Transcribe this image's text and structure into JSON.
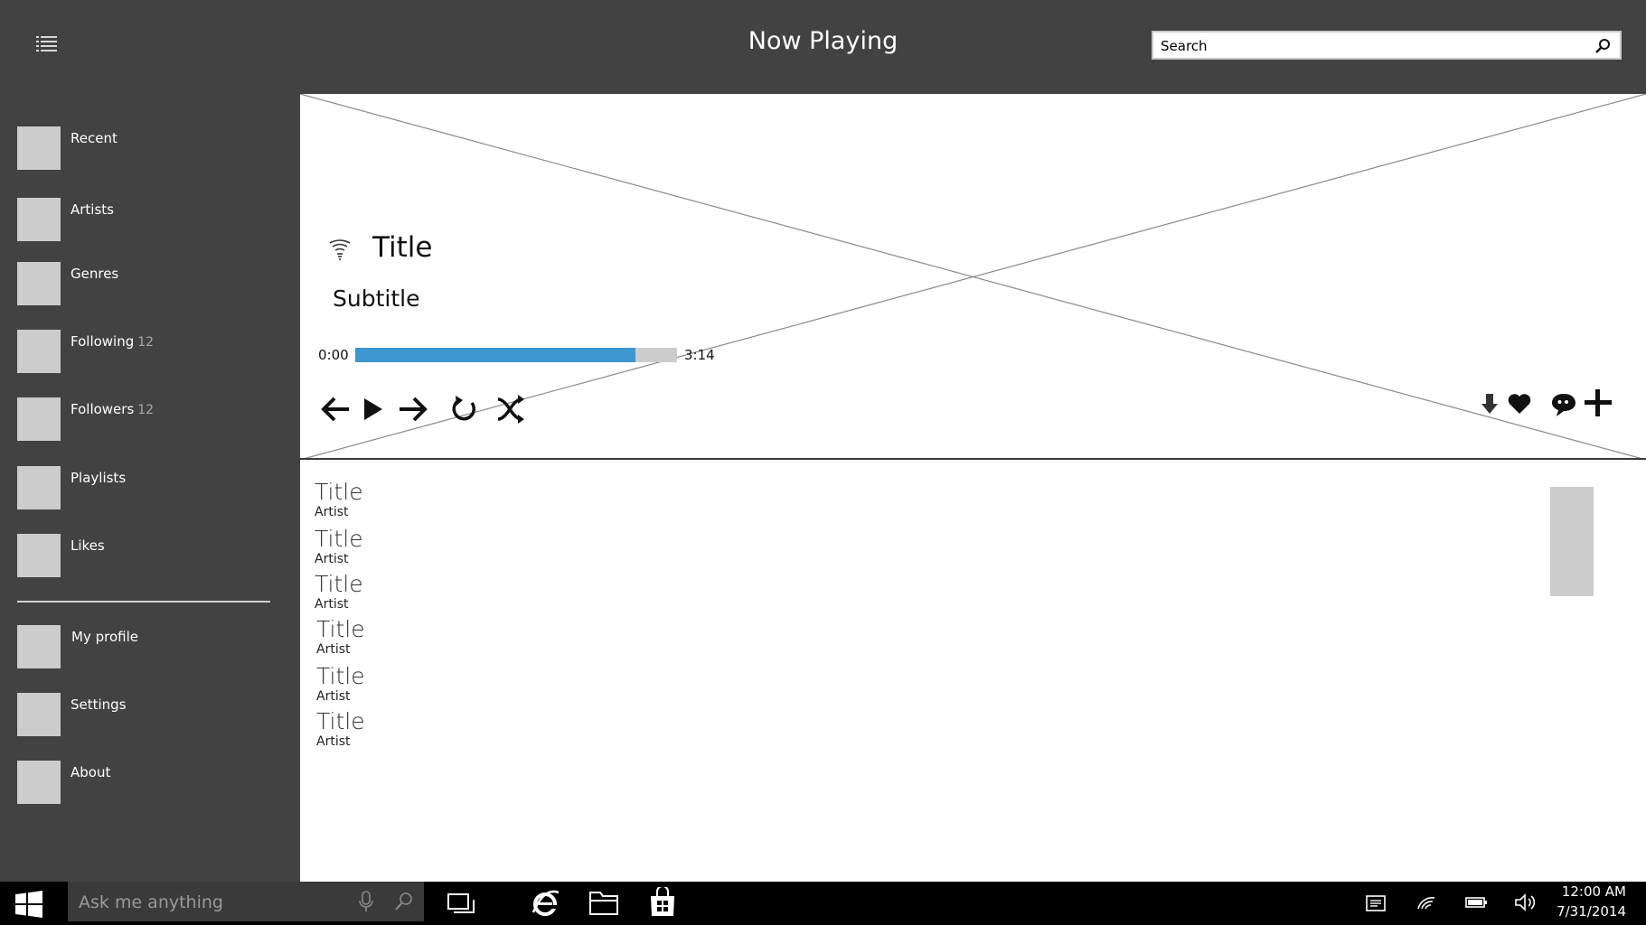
{
  "header": {
    "title": "Now Playing",
    "search_placeholder": "Search"
  },
  "sidebar": {
    "items": [
      {
        "label": "Recent",
        "count": ""
      },
      {
        "label": "Artists",
        "count": ""
      },
      {
        "label": "Genres",
        "count": ""
      },
      {
        "label": "Following",
        "count": "12"
      },
      {
        "label": "Followers",
        "count": "12"
      },
      {
        "label": "Playlists",
        "count": ""
      },
      {
        "label": "Likes",
        "count": ""
      }
    ],
    "secondary_items": [
      {
        "label": "My profile"
      },
      {
        "label": "Settings"
      },
      {
        "label": "About"
      }
    ]
  },
  "now_playing": {
    "title": "Title",
    "subtitle": "Subtitle",
    "time_current": "0:00",
    "time_total": "3:14",
    "progress": 0.87,
    "accent_color": "#3d97d1",
    "controls": [
      "arrow-left-icon",
      "play-icon",
      "arrow-right-icon",
      "repeat-icon",
      "shuffle-icon"
    ],
    "actions": [
      "download-icon",
      "heart-icon",
      "comment-icon",
      "plus-icon"
    ]
  },
  "tracks": [
    {
      "title": "Title",
      "artist": "Artist"
    },
    {
      "title": "Title",
      "artist": "Artist"
    },
    {
      "title": "Title",
      "artist": "Artist"
    },
    {
      "title": "Title",
      "artist": "Artist"
    },
    {
      "title": "Title",
      "artist": "Artist"
    },
    {
      "title": "Title",
      "artist": "Artist"
    }
  ],
  "taskbar": {
    "search_placeholder": "Ask me anything",
    "time": "12:00 AM",
    "date": "7/31/2014"
  }
}
